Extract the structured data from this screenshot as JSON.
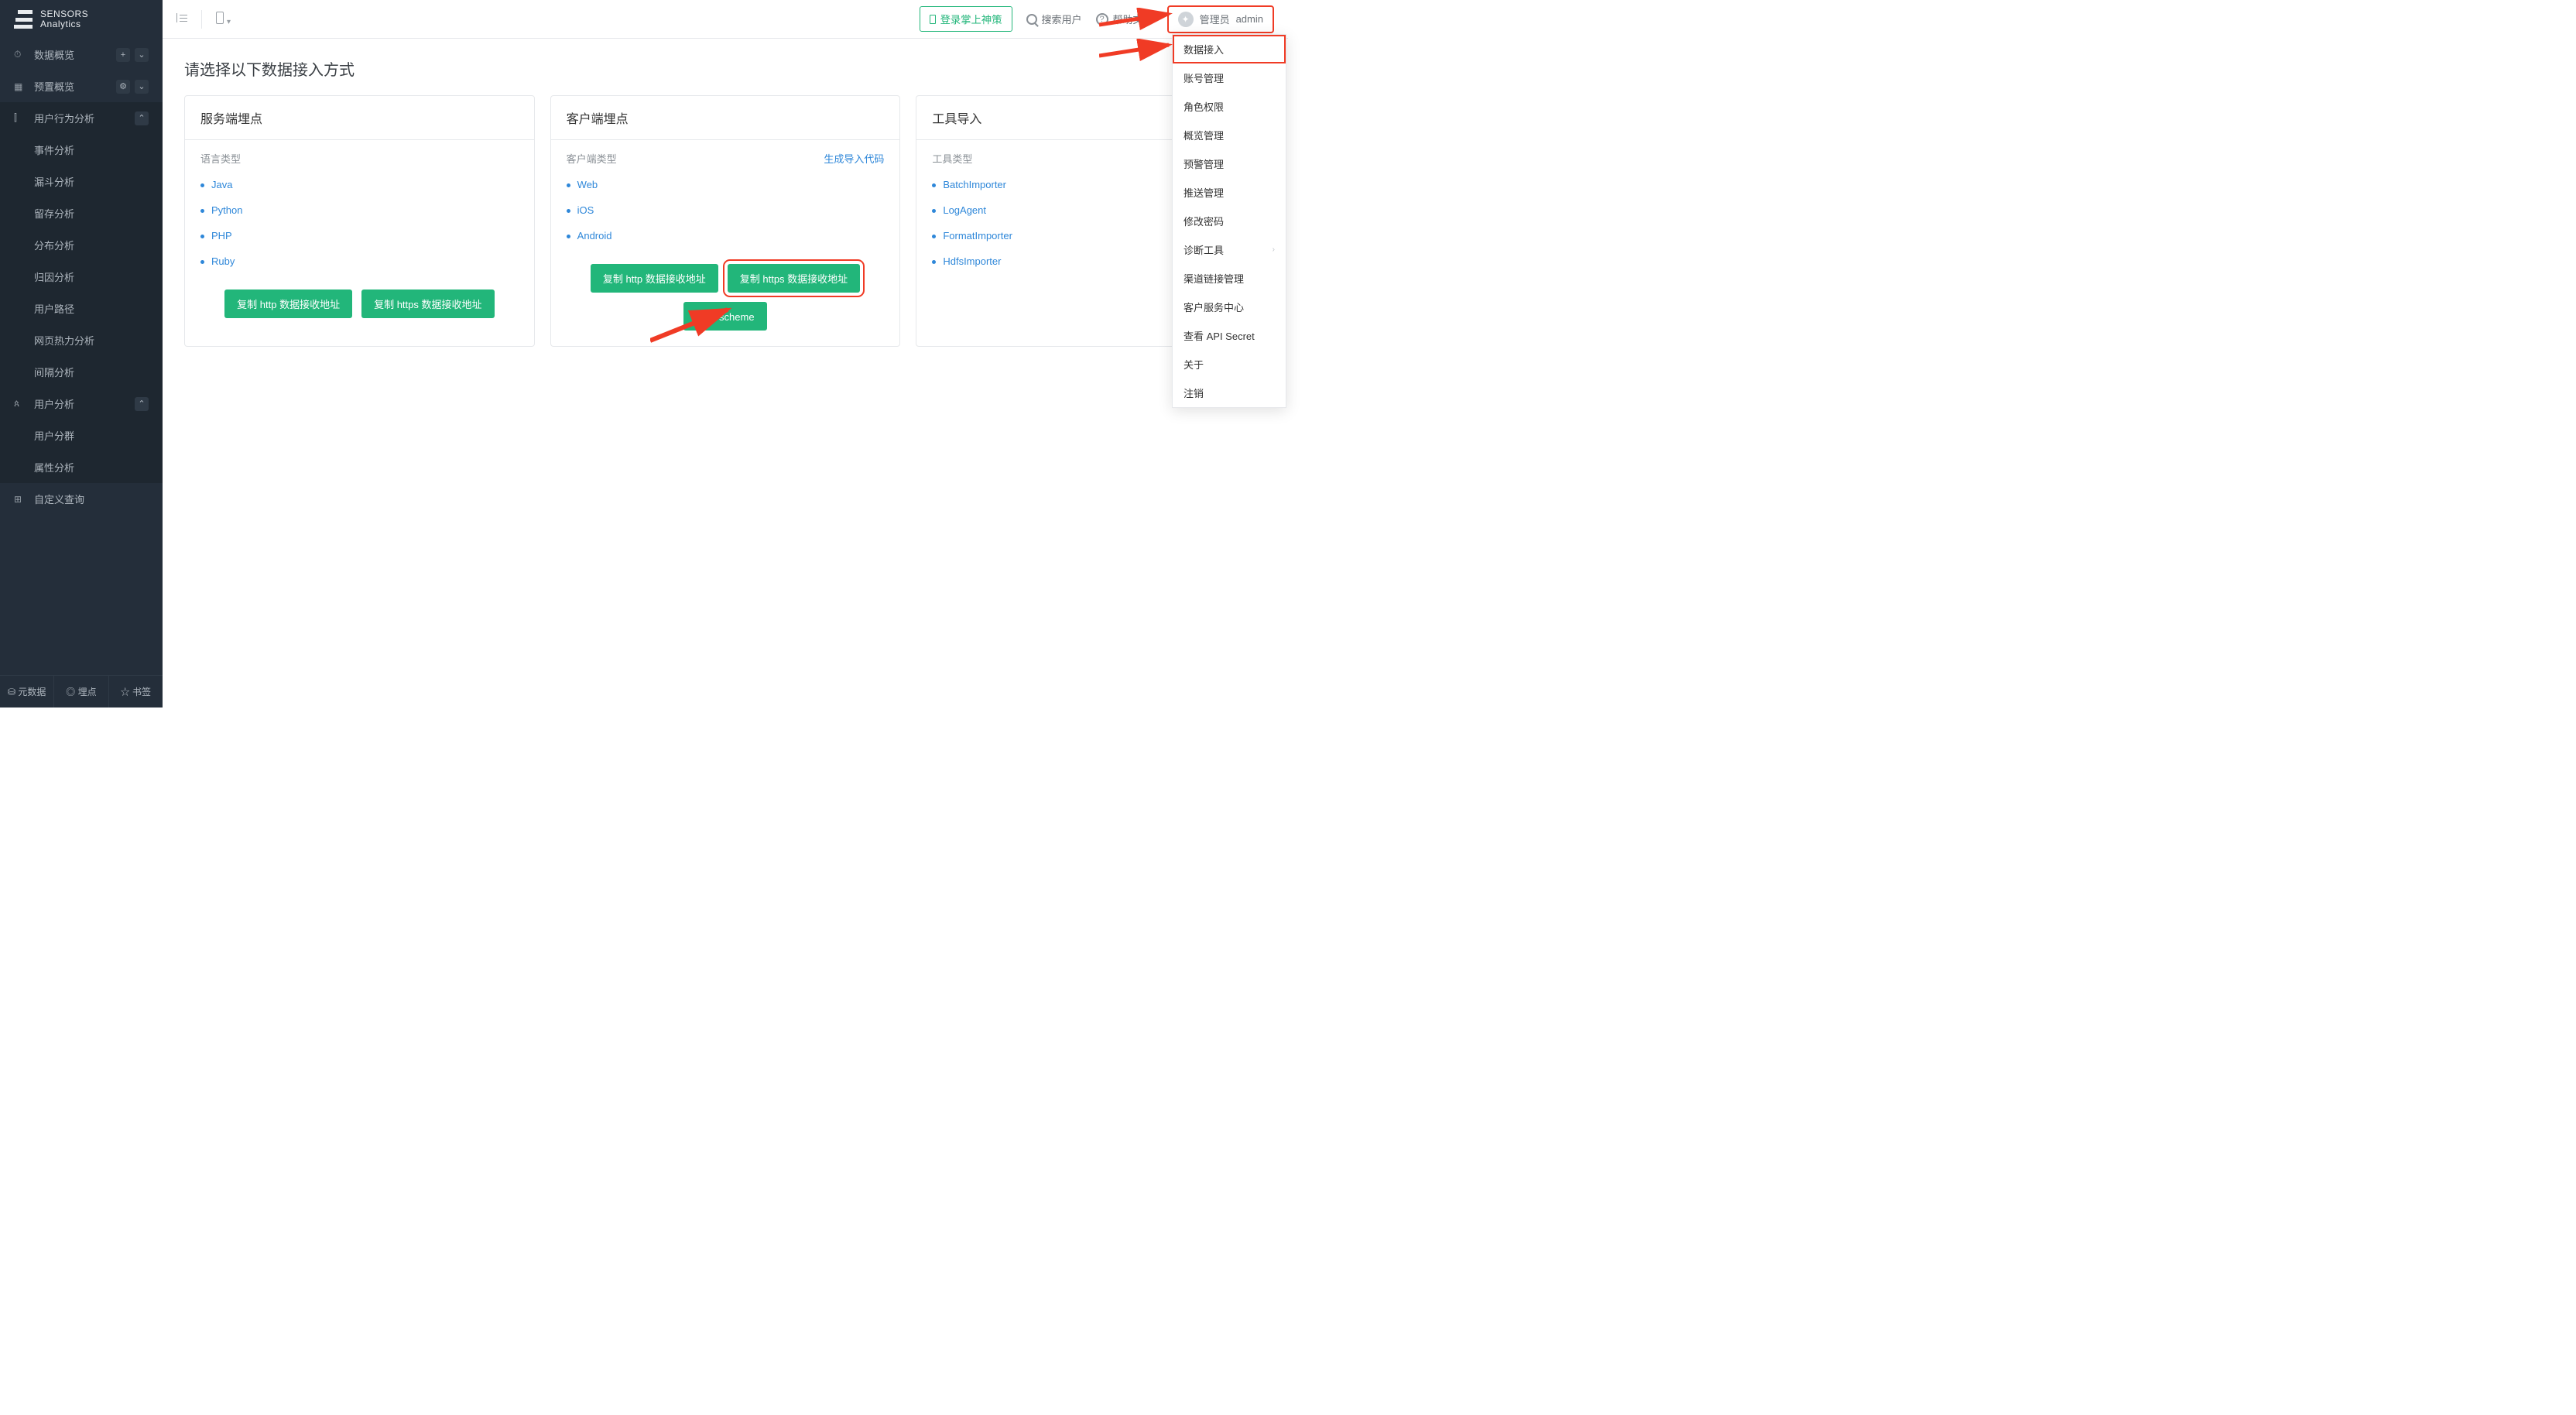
{
  "brand": {
    "line1": "SENSORS",
    "line2": "Analytics"
  },
  "sidebar": {
    "dataOverview": "数据概览",
    "presetOverview": "预置概览",
    "behavior": {
      "label": "用户行为分析",
      "items": [
        "事件分析",
        "漏斗分析",
        "留存分析",
        "分布分析",
        "归因分析",
        "用户路径",
        "网页热力分析",
        "间隔分析"
      ]
    },
    "userAnalysis": {
      "label": "用户分析",
      "items": [
        "用户分群",
        "属性分析"
      ]
    },
    "customQuery": "自定义查询",
    "footer": [
      "元数据",
      "埋点",
      "书签"
    ]
  },
  "topbar": {
    "loginBtn": "登录掌上神策",
    "search": "搜索用户",
    "help": "帮助文档",
    "userRole": "管理员",
    "userName": "admin"
  },
  "page": {
    "title": "请选择以下数据接入方式"
  },
  "cards": {
    "server": {
      "title": "服务端埋点",
      "subtitle": "语言类型",
      "items": [
        "Java",
        "Python",
        "PHP",
        "Ruby"
      ],
      "actions": [
        "复制 http 数据接收地址",
        "复制 https 数据接收地址"
      ]
    },
    "client": {
      "title": "客户端埋点",
      "subtitle": "客户端类型",
      "gen": "生成导入代码",
      "items": [
        "Web",
        "iOS",
        "Android"
      ],
      "actions": [
        "复制 http 数据接收地址",
        "复制 https 数据接收地址",
        "复制 scheme"
      ]
    },
    "tool": {
      "title": "工具导入",
      "subtitle": "工具类型",
      "items": [
        "BatchImporter",
        "LogAgent",
        "FormatImporter",
        "HdfsImporter"
      ]
    }
  },
  "dropdown": {
    "items": [
      "数据接入",
      "账号管理",
      "角色权限",
      "概览管理",
      "预警管理",
      "推送管理",
      "修改密码",
      "诊断工具",
      "渠道链接管理",
      "客户服务中心",
      "查看 API Secret",
      "关于",
      "注销"
    ]
  },
  "icons": {
    "plus": "+",
    "gear": "⚙",
    "chevUp": "⌃",
    "chevDown": "⌄",
    "star": "☆",
    "grid": "⊞",
    "caret": "▾",
    "db": "⛁",
    "target": "◎",
    "person": "👤",
    "chart": "📊",
    "dash": "🏁",
    "chevRight": "›"
  }
}
